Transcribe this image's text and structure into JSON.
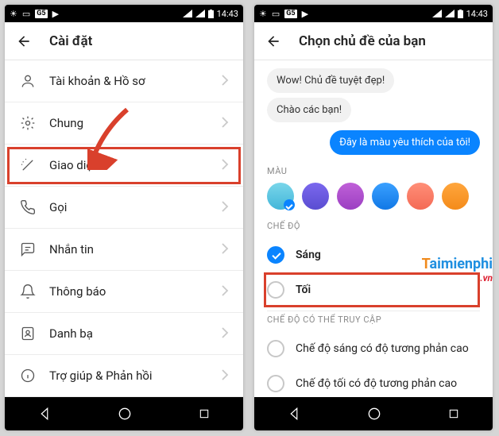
{
  "statusbar": {
    "time": "14:43"
  },
  "left": {
    "title": "Cài đặt",
    "rows": [
      {
        "key": "account",
        "label": "Tài khoản & Hồ sơ"
      },
      {
        "key": "general",
        "label": "Chung"
      },
      {
        "key": "theme",
        "label": "Giao diện",
        "highlight": true
      },
      {
        "key": "calling",
        "label": "Gọi"
      },
      {
        "key": "messaging",
        "label": "Nhắn tin"
      },
      {
        "key": "notif",
        "label": "Thông báo"
      },
      {
        "key": "contacts",
        "label": "Danh bạ"
      },
      {
        "key": "help",
        "label": "Trợ giúp & Phản hồi"
      }
    ]
  },
  "right": {
    "title": "Chọn chủ đề của bạn",
    "preview": {
      "msg1": "Wow! Chủ đề tuyệt đẹp!",
      "msg2": "Chào các bạn!",
      "msg3": "Đây là màu yêu thích của tôi!"
    },
    "sections": {
      "color": "MÀU",
      "mode": "CHẾ ĐỘ",
      "a11y": "CHẾ ĐỘ CÓ THỂ TRUY CẬP"
    },
    "swatches": [
      "cyan",
      "indigo",
      "purple",
      "blue",
      "coral",
      "orange"
    ],
    "selected_swatch": "cyan",
    "modes": {
      "light": "Sáng",
      "dark": "Tối",
      "hc_light": "Chế độ sáng có độ tương phản cao",
      "hc_dark": "Chế độ tối có độ tương phản cao"
    },
    "selected_mode": "light",
    "highlight_mode": "dark"
  },
  "watermark": {
    "text": "aimienphi",
    "suffix": ".vn"
  }
}
